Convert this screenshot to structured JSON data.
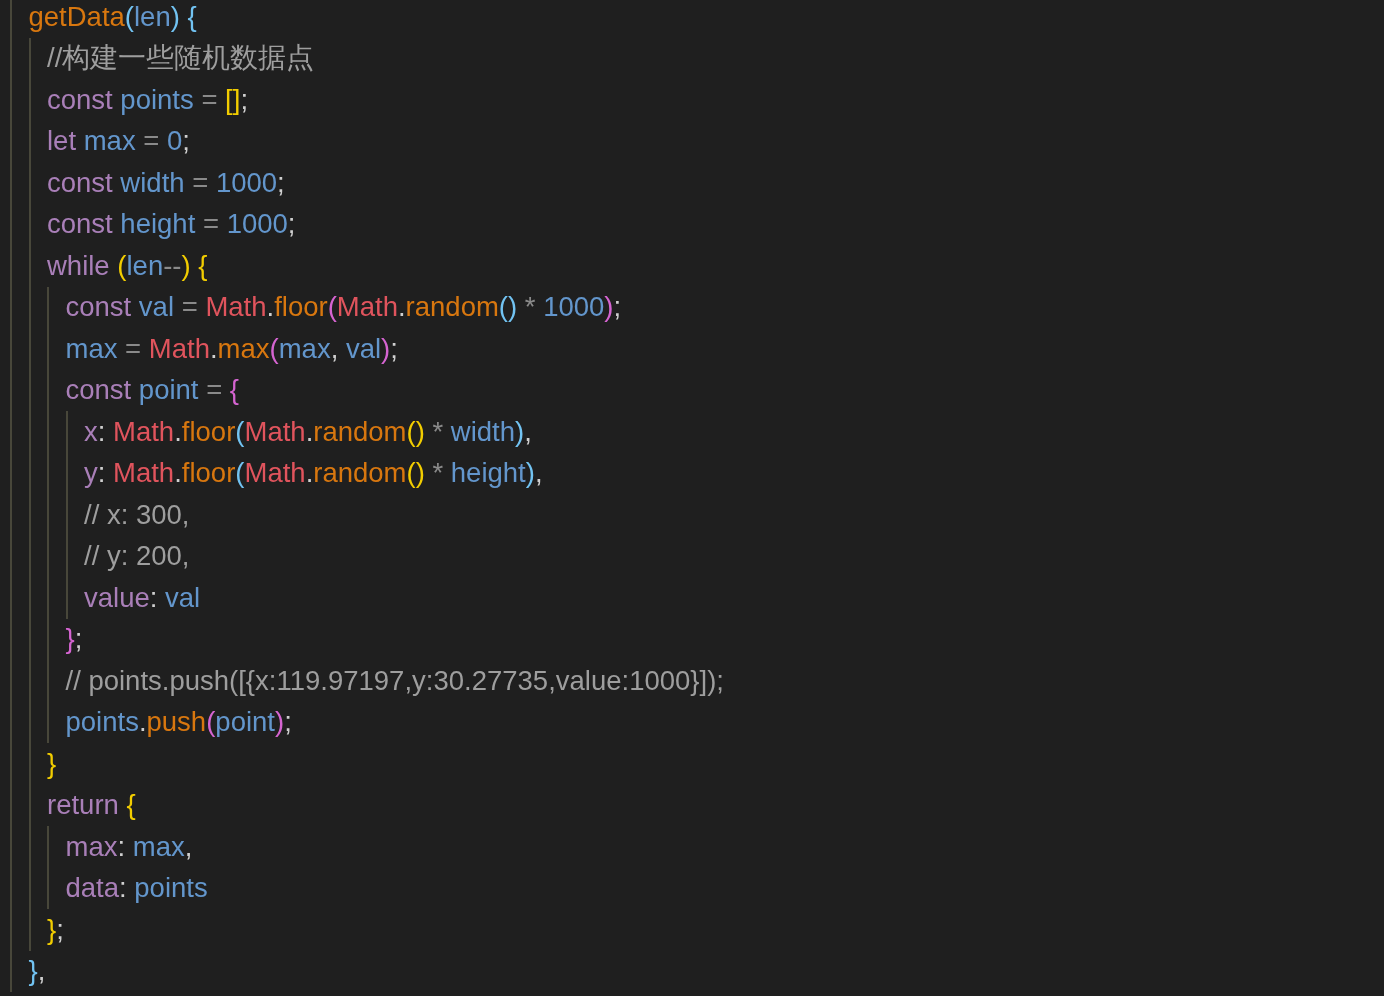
{
  "editor": {
    "lines": [
      {
        "tokens": [
          {
            "text": "getData",
            "color": "#d8770f"
          },
          {
            "text": "(",
            "color": "#72c3f2"
          },
          {
            "text": "len",
            "color": "#6396cc"
          },
          {
            "text": ") {",
            "color": "#72c3f2"
          }
        ],
        "children": [
          {
            "tokens": [
              {
                "text": "//构建一些随机数据点",
                "color": "#9e9e9e"
              }
            ]
          },
          {
            "tokens": [
              {
                "text": "const",
                "color": "#a97fb8"
              },
              {
                "text": " points",
                "color": "#6396cc"
              },
              {
                "text": " = ",
                "color": "#8a8a8a"
              },
              {
                "text": "[]",
                "color": "#f2cd00"
              },
              {
                "text": ";"
              }
            ]
          },
          {
            "tokens": [
              {
                "text": "let",
                "color": "#a97fb8"
              },
              {
                "text": " max",
                "color": "#6396cc"
              },
              {
                "text": " = ",
                "color": "#8a8a8a"
              },
              {
                "text": "0",
                "color": "#6396cc"
              },
              {
                "text": ";"
              }
            ]
          },
          {
            "tokens": [
              {
                "text": "const",
                "color": "#a97fb8"
              },
              {
                "text": " width",
                "color": "#6396cc"
              },
              {
                "text": " = ",
                "color": "#8a8a8a"
              },
              {
                "text": "1000",
                "color": "#6396cc"
              },
              {
                "text": ";"
              }
            ]
          },
          {
            "tokens": [
              {
                "text": "const",
                "color": "#a97fb8"
              },
              {
                "text": " height",
                "color": "#6396cc"
              },
              {
                "text": " = ",
                "color": "#8a8a8a"
              },
              {
                "text": "1000",
                "color": "#6396cc"
              },
              {
                "text": ";"
              }
            ]
          },
          {
            "tokens": [
              {
                "text": "while",
                "color": "#a97fb8"
              },
              {
                "text": " (",
                "color": "#f2cd00"
              },
              {
                "text": "len",
                "color": "#6396cc"
              },
              {
                "text": "--",
                "color": "#8a8a8a"
              },
              {
                "text": ") {",
                "color": "#f2cd00"
              }
            ],
            "children": [
              {
                "tokens": [
                  {
                    "text": "const",
                    "color": "#a97fb8"
                  },
                  {
                    "text": " val",
                    "color": "#6396cc"
                  },
                  {
                    "text": " = ",
                    "color": "#8a8a8a"
                  },
                  {
                    "text": "Math",
                    "color": "#e0545d"
                  },
                  {
                    "text": "."
                  },
                  {
                    "text": "floor",
                    "color": "#d8770f"
                  },
                  {
                    "text": "(",
                    "color": "#d564d1"
                  },
                  {
                    "text": "Math",
                    "color": "#e0545d"
                  },
                  {
                    "text": "."
                  },
                  {
                    "text": "random",
                    "color": "#d8770f"
                  },
                  {
                    "text": "()",
                    "color": "#72c3f2"
                  },
                  {
                    "text": " * ",
                    "color": "#8a8a8a"
                  },
                  {
                    "text": "1000",
                    "color": "#6396cc"
                  },
                  {
                    "text": ")",
                    "color": "#d564d1"
                  },
                  {
                    "text": ";"
                  }
                ]
              },
              {
                "tokens": [
                  {
                    "text": "max",
                    "color": "#6396cc"
                  },
                  {
                    "text": " = ",
                    "color": "#8a8a8a"
                  },
                  {
                    "text": "Math",
                    "color": "#e0545d"
                  },
                  {
                    "text": "."
                  },
                  {
                    "text": "max",
                    "color": "#d8770f"
                  },
                  {
                    "text": "(",
                    "color": "#d564d1"
                  },
                  {
                    "text": "max",
                    "color": "#6396cc"
                  },
                  {
                    "text": ", "
                  },
                  {
                    "text": "val",
                    "color": "#6396cc"
                  },
                  {
                    "text": ")",
                    "color": "#d564d1"
                  },
                  {
                    "text": ";"
                  }
                ]
              },
              {
                "tokens": [
                  {
                    "text": "const",
                    "color": "#a97fb8"
                  },
                  {
                    "text": " point",
                    "color": "#6396cc"
                  },
                  {
                    "text": " = ",
                    "color": "#8a8a8a"
                  },
                  {
                    "text": "{",
                    "color": "#d564d1"
                  }
                ],
                "children": [
                  {
                    "tokens": [
                      {
                        "text": "x",
                        "color": "#a97fb8"
                      },
                      {
                        "text": ": "
                      },
                      {
                        "text": "Math",
                        "color": "#e0545d"
                      },
                      {
                        "text": "."
                      },
                      {
                        "text": "floor",
                        "color": "#d8770f"
                      },
                      {
                        "text": "(",
                        "color": "#72c3f2"
                      },
                      {
                        "text": "Math",
                        "color": "#e0545d"
                      },
                      {
                        "text": "."
                      },
                      {
                        "text": "random",
                        "color": "#d8770f"
                      },
                      {
                        "text": "()",
                        "color": "#f2cd00"
                      },
                      {
                        "text": " * ",
                        "color": "#8a8a8a"
                      },
                      {
                        "text": "width",
                        "color": "#6396cc"
                      },
                      {
                        "text": ")",
                        "color": "#72c3f2"
                      },
                      {
                        "text": ","
                      }
                    ]
                  },
                  {
                    "tokens": [
                      {
                        "text": "y",
                        "color": "#a97fb8"
                      },
                      {
                        "text": ": "
                      },
                      {
                        "text": "Math",
                        "color": "#e0545d"
                      },
                      {
                        "text": "."
                      },
                      {
                        "text": "floor",
                        "color": "#d8770f"
                      },
                      {
                        "text": "(",
                        "color": "#72c3f2"
                      },
                      {
                        "text": "Math",
                        "color": "#e0545d"
                      },
                      {
                        "text": "."
                      },
                      {
                        "text": "random",
                        "color": "#d8770f"
                      },
                      {
                        "text": "()",
                        "color": "#f2cd00"
                      },
                      {
                        "text": " * ",
                        "color": "#8a8a8a"
                      },
                      {
                        "text": "height",
                        "color": "#6396cc"
                      },
                      {
                        "text": ")",
                        "color": "#72c3f2"
                      },
                      {
                        "text": ","
                      }
                    ]
                  },
                  {
                    "tokens": [
                      {
                        "text": "// x: 300,",
                        "color": "#9e9e9e"
                      }
                    ]
                  },
                  {
                    "tokens": [
                      {
                        "text": "// y: 200,",
                        "color": "#9e9e9e"
                      }
                    ]
                  },
                  {
                    "tokens": [
                      {
                        "text": "value",
                        "color": "#a97fb8"
                      },
                      {
                        "text": ": "
                      },
                      {
                        "text": "val",
                        "color": "#6396cc"
                      }
                    ]
                  }
                ]
              },
              {
                "tokens": [
                  {
                    "text": "}",
                    "color": "#d564d1"
                  },
                  {
                    "text": ";"
                  }
                ]
              },
              {
                "tokens": [
                  {
                    "text": "// points.push([{x:119.97197,y:30.27735,value:1000}]);",
                    "color": "#9e9e9e"
                  }
                ]
              },
              {
                "tokens": [
                  {
                    "text": "points",
                    "color": "#6396cc"
                  },
                  {
                    "text": "."
                  },
                  {
                    "text": "push",
                    "color": "#d8770f"
                  },
                  {
                    "text": "(",
                    "color": "#d564d1"
                  },
                  {
                    "text": "point",
                    "color": "#6396cc"
                  },
                  {
                    "text": ")",
                    "color": "#d564d1"
                  },
                  {
                    "text": ";"
                  }
                ]
              }
            ]
          },
          {
            "tokens": [
              {
                "text": "}",
                "color": "#f2cd00"
              }
            ]
          },
          {
            "tokens": [
              {
                "text": "return",
                "color": "#a97fb8"
              },
              {
                "text": " {",
                "color": "#f2cd00"
              }
            ],
            "children": [
              {
                "tokens": [
                  {
                    "text": "max",
                    "color": "#a97fb8"
                  },
                  {
                    "text": ": "
                  },
                  {
                    "text": "max",
                    "color": "#6396cc"
                  },
                  {
                    "text": ","
                  }
                ]
              },
              {
                "tokens": [
                  {
                    "text": "data",
                    "color": "#a97fb8"
                  },
                  {
                    "text": ": "
                  },
                  {
                    "text": "points",
                    "color": "#6396cc"
                  }
                ]
              }
            ]
          },
          {
            "tokens": [
              {
                "text": "}",
                "color": "#f2cd00"
              },
              {
                "text": ";"
              }
            ]
          }
        ]
      },
      {
        "tokens": [
          {
            "text": "}",
            "color": "#72c3f2"
          },
          {
            "text": ","
          }
        ]
      }
    ]
  }
}
